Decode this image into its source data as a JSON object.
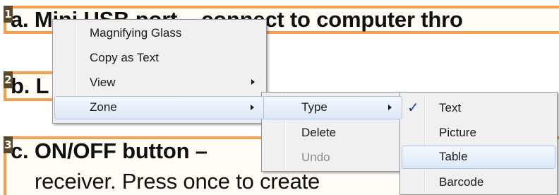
{
  "document": {
    "zones": [
      {
        "number": "1",
        "text": "a. Mini USB port – connect to computer thro"
      },
      {
        "number": "2",
        "text": "b. L"
      },
      {
        "number": "3",
        "line1": "c. ON/OFF button –",
        "line2": "receiver.  Press once to create"
      }
    ]
  },
  "context_menu": {
    "items": [
      {
        "label": "Magnifying Glass"
      },
      {
        "label": "Copy as Text"
      },
      {
        "label": "View",
        "submenu": true
      },
      {
        "label": "Zone",
        "submenu": true,
        "highlighted": true
      }
    ]
  },
  "zone_submenu": {
    "items": [
      {
        "label": "Type",
        "submenu": true,
        "highlighted": true
      },
      {
        "label": "Delete"
      },
      {
        "label": "Undo",
        "disabled": true
      }
    ]
  },
  "type_submenu": {
    "items": [
      {
        "label": "Text",
        "checked": true,
        "check_glyph": "✓"
      },
      {
        "label": "Picture"
      },
      {
        "label": "Table",
        "highlighted": true
      },
      {
        "label": "Barcode"
      }
    ]
  },
  "colors": {
    "zone_border": "#f6a04e",
    "menu_background": "#f0f0f0",
    "highlight": "#dce8f8",
    "check": "#1c3f9c"
  }
}
